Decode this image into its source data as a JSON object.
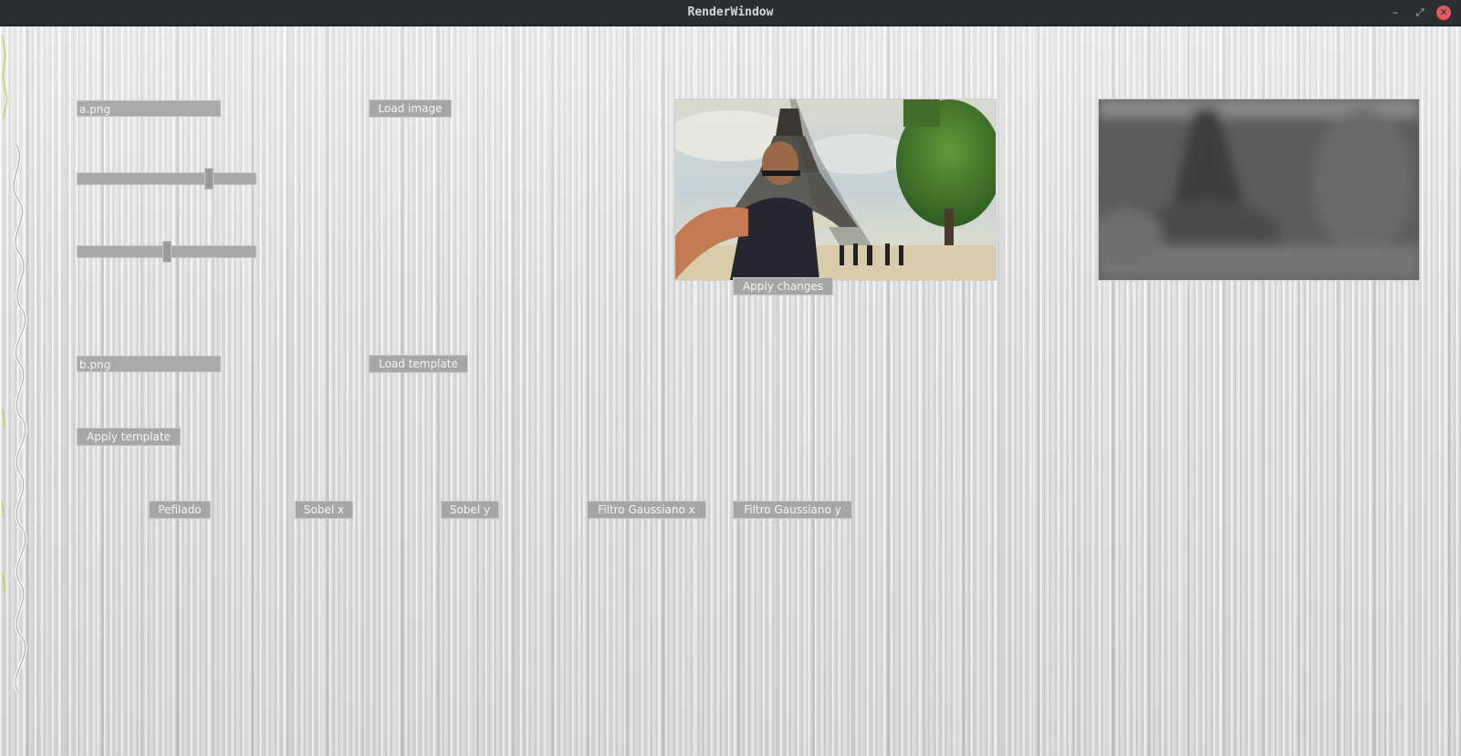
{
  "window": {
    "title": "RenderWindow",
    "controls": {
      "minimize_glyph": "–",
      "maximize_glyph": "⤢",
      "close_glyph": "✕"
    },
    "close_color": "#e25a5a"
  },
  "inputs": {
    "image_path": "a.png",
    "template_path": "b.png"
  },
  "sliders": [
    {
      "name": "slider-1",
      "value_fraction": 0.74
    },
    {
      "name": "slider-2",
      "value_fraction": 0.5
    }
  ],
  "buttons": {
    "load_image": "Load image",
    "load_template": "Load template",
    "apply_template": "Apply template",
    "apply_changes": "Apply changes",
    "pefilado": "Pefilado",
    "sobel_x": "Sobel x",
    "sobel_y": "Sobel y",
    "gauss_x": "Filtro Gaussiano x",
    "gauss_y": "Filtro Gaussiano y"
  },
  "images": {
    "original": "color-photo",
    "processed": "grayscale-blurred-photo"
  }
}
